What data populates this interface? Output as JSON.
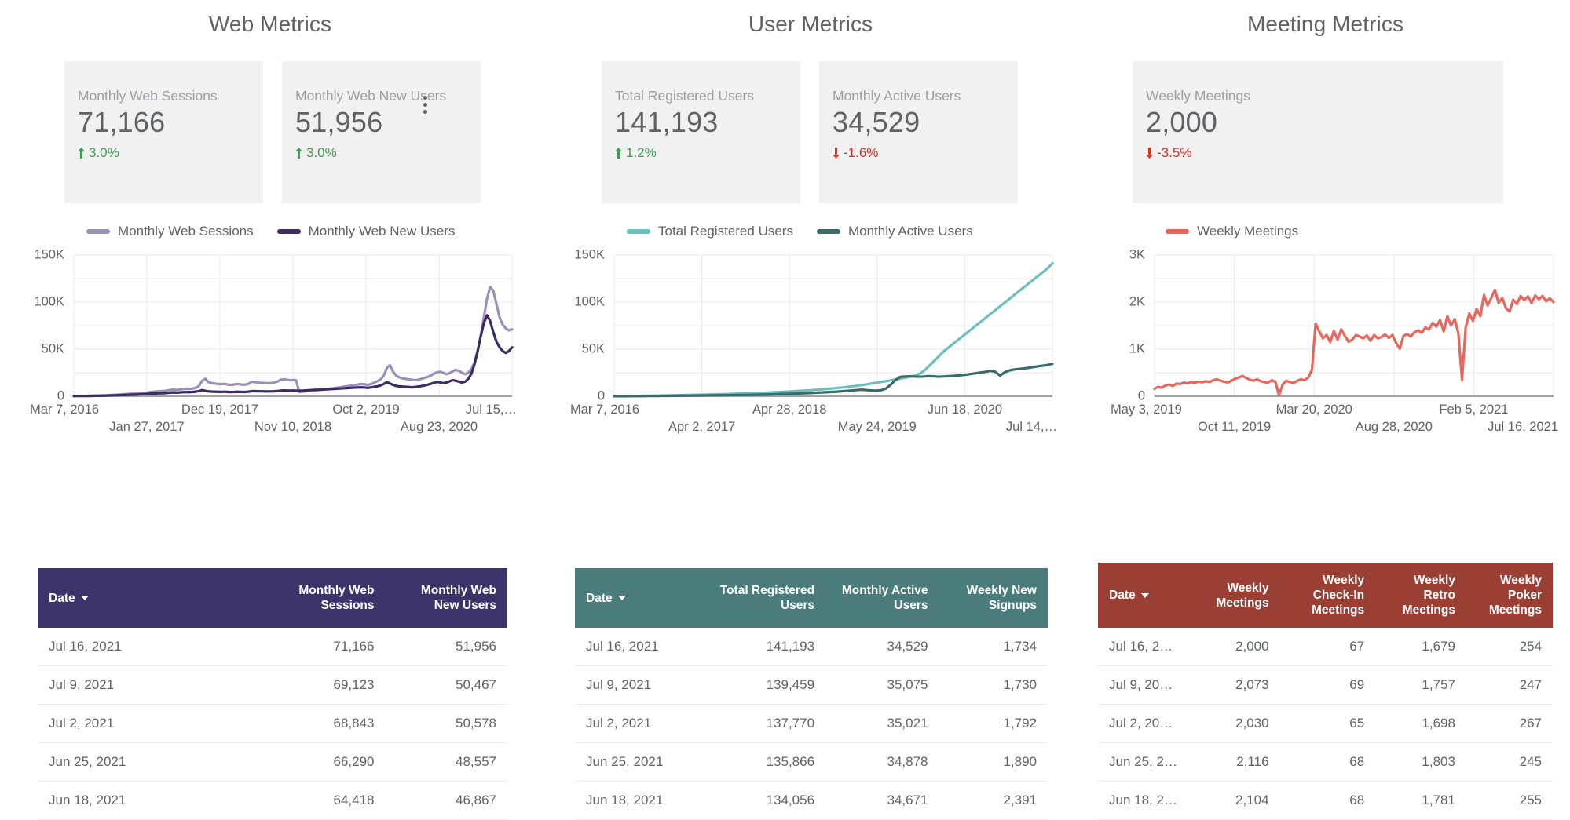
{
  "panels": [
    {
      "key": "web",
      "title": "Web Metrics",
      "accent": "#3d336b",
      "scorecards": [
        {
          "label": "Monthly Web Sessions",
          "value": "71,166",
          "delta": "3.0%",
          "direction": "up"
        },
        {
          "label": "Monthly Web New Users",
          "value": "51,956",
          "delta": "3.0%",
          "direction": "up"
        }
      ],
      "has_more_menu": true,
      "table": {
        "columns": [
          "Date",
          "Monthly Web Sessions",
          "Monthly Web New Users"
        ],
        "sort_column": "Date",
        "rows": [
          [
            "Jul 16, 2021",
            "71,166",
            "51,956"
          ],
          [
            "Jul 9, 2021",
            "69,123",
            "50,467"
          ],
          [
            "Jul 2, 2021",
            "68,843",
            "50,578"
          ],
          [
            "Jun 25, 2021",
            "66,290",
            "48,557"
          ],
          [
            "Jun 18, 2021",
            "64,418",
            "46,867"
          ]
        ]
      }
    },
    {
      "key": "user",
      "title": "User Metrics",
      "accent": "#4a7c7c",
      "scorecards": [
        {
          "label": "Total Registered Users",
          "value": "141,193",
          "delta": "1.2%",
          "direction": "up"
        },
        {
          "label": "Monthly Active Users",
          "value": "34,529",
          "delta": "-1.6%",
          "direction": "down"
        }
      ],
      "has_more_menu": false,
      "table": {
        "columns": [
          "Date",
          "Total Registered Users",
          "Monthly Active Users",
          "Weekly New Signups"
        ],
        "sort_column": "Date",
        "rows": [
          [
            "Jul 16, 2021",
            "141,193",
            "34,529",
            "1,734"
          ],
          [
            "Jul 9, 2021",
            "139,459",
            "35,075",
            "1,730"
          ],
          [
            "Jul 2, 2021",
            "137,770",
            "35,021",
            "1,792"
          ],
          [
            "Jun 25, 2021",
            "135,866",
            "34,878",
            "1,890"
          ],
          [
            "Jun 18, 2021",
            "134,056",
            "34,671",
            "2,391"
          ]
        ]
      }
    },
    {
      "key": "meet",
      "title": "Meeting Metrics",
      "accent": "#9b3f34",
      "scorecards": [
        {
          "label": "Weekly Meetings",
          "value": "2,000",
          "delta": "-3.5%",
          "direction": "down"
        }
      ],
      "has_more_menu": false,
      "table": {
        "columns": [
          "Date",
          "Weekly Meetings",
          "Weekly Check-In Meetings",
          "Weekly Retro Meetings",
          "Weekly Poker Meetings"
        ],
        "sort_column": "Date",
        "rows": [
          [
            "Jul 16, 2…",
            "2,000",
            "67",
            "1,679",
            "254"
          ],
          [
            "Jul 9, 20…",
            "2,073",
            "69",
            "1,757",
            "247"
          ],
          [
            "Jul 2, 20…",
            "2,030",
            "65",
            "1,698",
            "267"
          ],
          [
            "Jun 25, 2…",
            "2,116",
            "68",
            "1,803",
            "245"
          ],
          [
            "Jun 18, 2…",
            "2,104",
            "68",
            "1,781",
            "255"
          ]
        ]
      }
    }
  ],
  "chart_data": [
    {
      "type": "line",
      "panel": "web",
      "title": "Web Metrics",
      "xlabel": "",
      "ylabel": "",
      "ylim": [
        0,
        150000
      ],
      "yticks": [
        "0",
        "50K",
        "100K",
        "150K"
      ],
      "ytick_values": [
        0,
        50000,
        100000,
        150000
      ],
      "grid": true,
      "legend_position": "top",
      "xtick_labels": [
        "Mar 7, 2016",
        "Jan 27, 2017",
        "Dec 19, 2017",
        "Nov 10, 2018",
        "Oct 2, 2019",
        "Aug 23, 2020",
        "Jul 15,…"
      ],
      "series": [
        {
          "name": "Monthly Web Sessions",
          "color": "#9c8fb8",
          "values": [
            300,
            350,
            420,
            380,
            450,
            500,
            600,
            700,
            800,
            900,
            1000,
            1200,
            1400,
            1500,
            1700,
            1900,
            2100,
            2400,
            2600,
            2800,
            3000,
            3400,
            3600,
            3800,
            4200,
            4600,
            5000,
            5200,
            5400,
            5600,
            6200,
            6800,
            7000,
            6600,
            7200,
            7600,
            8000,
            7800,
            8200,
            9000,
            11000,
            16500,
            18500,
            15000,
            14000,
            13500,
            13000,
            12800,
            13200,
            12600,
            12000,
            12400,
            13000,
            12800,
            12200,
            12500,
            13500,
            15500,
            15000,
            14500,
            14200,
            14000,
            13800,
            14000,
            14500,
            15500,
            17500,
            18000,
            17500,
            17000,
            17200,
            17000,
            4500,
            4800,
            5200,
            5600,
            6000,
            6400,
            6600,
            7000,
            7400,
            7800,
            8200,
            8600,
            9000,
            9400,
            10000,
            10600,
            11000,
            11400,
            12000,
            12600,
            13000,
            12600,
            12000,
            13000,
            14500,
            16000,
            18000,
            22000,
            30000,
            33000,
            26000,
            22000,
            20000,
            19000,
            18500,
            18000,
            17500,
            17000,
            17500,
            18500,
            19500,
            20500,
            22000,
            24000,
            25500,
            26000,
            25000,
            23500,
            24500,
            26500,
            28000,
            27000,
            25000,
            23500,
            25000,
            29000,
            36000,
            48000,
            64000,
            84000,
            104000,
            116000,
            112000,
            98000,
            84000,
            76000,
            72000,
            70000,
            71166
          ],
          "last_value": 71166
        },
        {
          "name": "Monthly Web New Users",
          "color": "#3d2b63",
          "values": [
            200,
            240,
            280,
            260,
            300,
            340,
            400,
            460,
            520,
            600,
            660,
            780,
            900,
            980,
            1100,
            1200,
            1350,
            1500,
            1650,
            1800,
            1900,
            2100,
            2250,
            2400,
            2600,
            2800,
            3000,
            3100,
            3200,
            3300,
            3600,
            3900,
            4000,
            3800,
            4100,
            4300,
            4500,
            4400,
            4600,
            5000,
            5500,
            6500,
            5800,
            5200,
            5000,
            4900,
            4800,
            4700,
            4850,
            4700,
            4500,
            4600,
            4800,
            4700,
            4600,
            4700,
            5000,
            5500,
            5400,
            5300,
            5250,
            5200,
            5150,
            5200,
            5300,
            5500,
            6000,
            6200,
            6100,
            6000,
            6050,
            6000,
            5800,
            6000,
            6200,
            6400,
            6600,
            6800,
            6900,
            7000,
            7200,
            7400,
            7600,
            7800,
            8000,
            8200,
            8400,
            8600,
            8800,
            9000,
            9200,
            9400,
            9500,
            9200,
            8900,
            9400,
            10000,
            10600,
            11500,
            13000,
            15000,
            13500,
            12000,
            11000,
            10500,
            10200,
            10000,
            9800,
            9500,
            9800,
            10200,
            10800,
            11400,
            12200,
            13200,
            14200,
            15200,
            14800,
            13800,
            14500,
            15800,
            17000,
            16500,
            15500,
            14500,
            15500,
            18500,
            24000,
            34000,
            48000,
            64000,
            78000,
            86000,
            80000,
            68000,
            58000,
            52000,
            48000,
            46000,
            48000,
            51956
          ],
          "last_value": 51956
        }
      ]
    },
    {
      "type": "line",
      "panel": "user",
      "title": "User Metrics",
      "xlabel": "",
      "ylabel": "",
      "ylim": [
        0,
        150000
      ],
      "yticks": [
        "0",
        "50K",
        "100K",
        "150K"
      ],
      "ytick_values": [
        0,
        50000,
        100000,
        150000
      ],
      "grid": true,
      "legend_position": "top",
      "xtick_labels": [
        "Mar 7, 2016",
        "Apr 2, 2017",
        "Apr 28, 2018",
        "May 24, 2019",
        "Jun 18, 2020",
        "Jul 14,…"
      ],
      "series": [
        {
          "name": "Total Registered Users",
          "color": "#6bbfbf",
          "values": [
            100,
            150,
            200,
            260,
            320,
            380,
            450,
            520,
            600,
            680,
            760,
            850,
            950,
            1050,
            1150,
            1250,
            1350,
            1450,
            1550,
            1680,
            1800,
            1950,
            2100,
            2250,
            2400,
            2550,
            2700,
            2850,
            3000,
            3200,
            3400,
            3600,
            3800,
            4000,
            4250,
            4500,
            4750,
            5000,
            5300,
            5600,
            5900,
            6200,
            6500,
            6900,
            7300,
            7700,
            8100,
            8600,
            9100,
            9600,
            10200,
            10800,
            11500,
            12200,
            13000,
            13800,
            14600,
            15500,
            16300,
            17200,
            18000,
            19000,
            20000,
            21000,
            22000,
            24500,
            28000,
            33000,
            38000,
            43000,
            48000,
            52000,
            56000,
            60000,
            64000,
            68000,
            72000,
            76000,
            80000,
            84000,
            88000,
            92000,
            96000,
            100000,
            104000,
            108000,
            112000,
            116000,
            120000,
            124000,
            128000,
            132000,
            136000,
            141193
          ],
          "last_value": 141193
        },
        {
          "name": "Monthly Active Users",
          "color": "#3a6b6b",
          "values": [
            60,
            80,
            100,
            130,
            160,
            190,
            220,
            260,
            300,
            340,
            380,
            420,
            470,
            520,
            570,
            620,
            680,
            740,
            800,
            860,
            920,
            980,
            1050,
            1120,
            1190,
            1260,
            1340,
            1420,
            1500,
            1600,
            1700,
            1800,
            1900,
            2000,
            2150,
            2300,
            2450,
            2600,
            2800,
            3000,
            3200,
            3400,
            3650,
            3900,
            4150,
            4400,
            4700,
            5000,
            5400,
            5800,
            6200,
            6600,
            7000,
            6500,
            6200,
            6000,
            6400,
            8000,
            12000,
            17000,
            20500,
            21000,
            21200,
            21000,
            20800,
            21000,
            21500,
            21200,
            20800,
            21000,
            21300,
            21600,
            22000,
            22500,
            23000,
            23800,
            24500,
            25200,
            26000,
            27000,
            26000,
            22000,
            25500,
            27500,
            28500,
            29000,
            29500,
            30200,
            31000,
            31800,
            32500,
            33200,
            34529
          ],
          "last_value": 34529
        }
      ]
    },
    {
      "type": "line",
      "panel": "meet",
      "title": "Meeting Metrics",
      "xlabel": "",
      "ylabel": "",
      "ylim": [
        0,
        3000
      ],
      "yticks": [
        "0",
        "1K",
        "2K",
        "3K"
      ],
      "ytick_values": [
        0,
        1000,
        2000,
        3000
      ],
      "grid": true,
      "legend_position": "top",
      "xtick_labels": [
        "May 3, 2019",
        "Oct 11, 2019",
        "Mar 20, 2020",
        "Aug 28, 2020",
        "Feb 5, 2021",
        "Jul 16, 2021"
      ],
      "series": [
        {
          "name": "Weekly Meetings",
          "color": "#e8665c",
          "values": [
            160,
            200,
            180,
            230,
            250,
            220,
            270,
            260,
            290,
            275,
            300,
            285,
            310,
            295,
            320,
            300,
            340,
            360,
            330,
            310,
            290,
            330,
            370,
            400,
            430,
            390,
            350,
            330,
            360,
            320,
            300,
            290,
            340,
            310,
            20,
            250,
            330,
            300,
            280,
            330,
            360,
            340,
            400,
            560,
            1540,
            1380,
            1230,
            1300,
            1150,
            1390,
            1200,
            1420,
            1280,
            1160,
            1200,
            1300,
            1270,
            1230,
            1290,
            1180,
            1300,
            1230,
            1260,
            1310,
            1240,
            1300,
            1130,
            1010,
            1280,
            1320,
            1270,
            1360,
            1400,
            1350,
            1460,
            1420,
            1560,
            1480,
            1620,
            1380,
            1700,
            1500,
            1640,
            1340,
            350,
            1460,
            1760,
            1600,
            1860,
            1700,
            2150,
            1930,
            2090,
            2260,
            1980,
            2090,
            1870,
            1800,
            2050,
            1960,
            2130,
            2040,
            2120,
            1980,
            2140,
            2060,
            2130,
            2020,
            2080,
            2000
          ],
          "last_value": 2000
        }
      ]
    }
  ]
}
